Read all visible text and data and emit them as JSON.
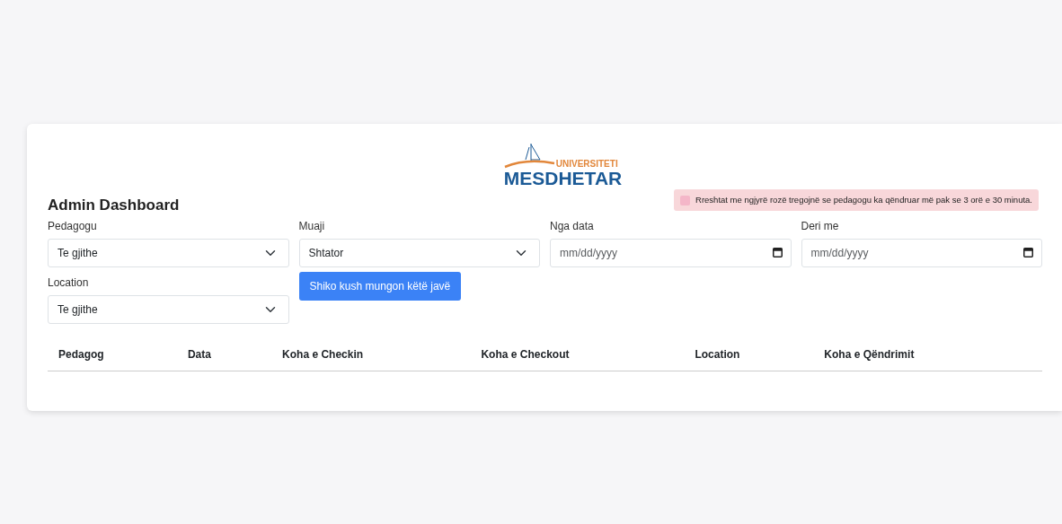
{
  "logo": {
    "line_1": "UNIVERSITETI",
    "line_2": "MESDHETAR"
  },
  "legend": {
    "color": "#f4b6c8",
    "text": "Rreshtat me ngjyrë rozë tregojnë se pedagogu ka qëndruar më pak se 3 orë e 30 minuta."
  },
  "title": "Admin Dashboard",
  "filters": [
    {
      "kind": "select",
      "label": "Pedagogu",
      "value": "Te gjithe"
    },
    {
      "kind": "select",
      "label": "Muaji",
      "value": "Shtator"
    },
    {
      "kind": "date",
      "label": "Nga data",
      "placeholder": "mm/dd/yyyy"
    },
    {
      "kind": "date",
      "label": "Deri me",
      "placeholder": "mm/dd/yyyy"
    },
    {
      "kind": "select",
      "label": "Location",
      "value": "Te gjithe"
    },
    {
      "kind": "button",
      "label": "Shiko kush mungon këtë javë"
    }
  ],
  "table": {
    "columns": [
      "Pedagog",
      "Data",
      "Koha e Checkin",
      "Koha e Checkout",
      "Location",
      "Koha e Qëndrimit"
    ]
  }
}
